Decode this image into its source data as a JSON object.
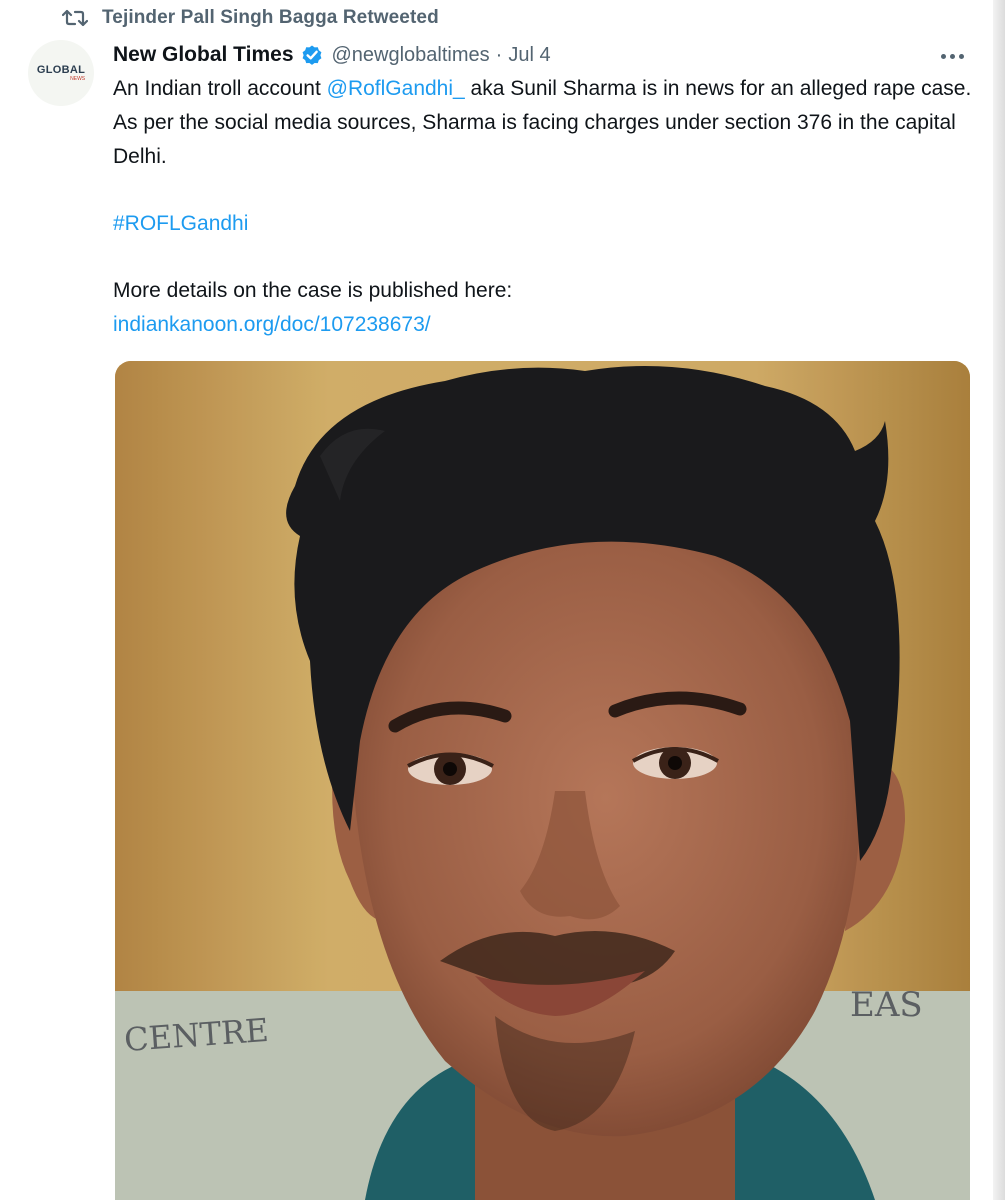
{
  "retweet": {
    "text": "Tejinder Pall Singh Bagga Retweeted"
  },
  "author": {
    "name": "New Global Times",
    "handle": "@newglobaltimes",
    "separator": "·",
    "date": "Jul 4",
    "avatar_text": "GLOBAL",
    "avatar_subtext": "NEWS"
  },
  "tweet": {
    "line1_prefix": "An Indian troll account",
    "mention": "@RoflGandhi_",
    "line1_suffix": " aka Sunil Sharma is in news for an alleged rape case. As per the social media sources, Sharma is facing charges under section 376 in the capital Delhi.",
    "hashtag": "#ROFLGandhi",
    "details_text": "More details on the case is published here:",
    "link": "indiankanoon.org/doc/107238673/"
  },
  "media": {
    "wall_text_left": "CENTRE",
    "wall_text_right": "EAS"
  },
  "icons": {
    "retweet": "retweet-icon",
    "verified": "verified-badge-icon",
    "more": "more-icon"
  },
  "colors": {
    "link": "#1d9bf0",
    "secondary_text": "#536471",
    "primary_text": "#0f1419",
    "verified": "#1d9bf0"
  }
}
